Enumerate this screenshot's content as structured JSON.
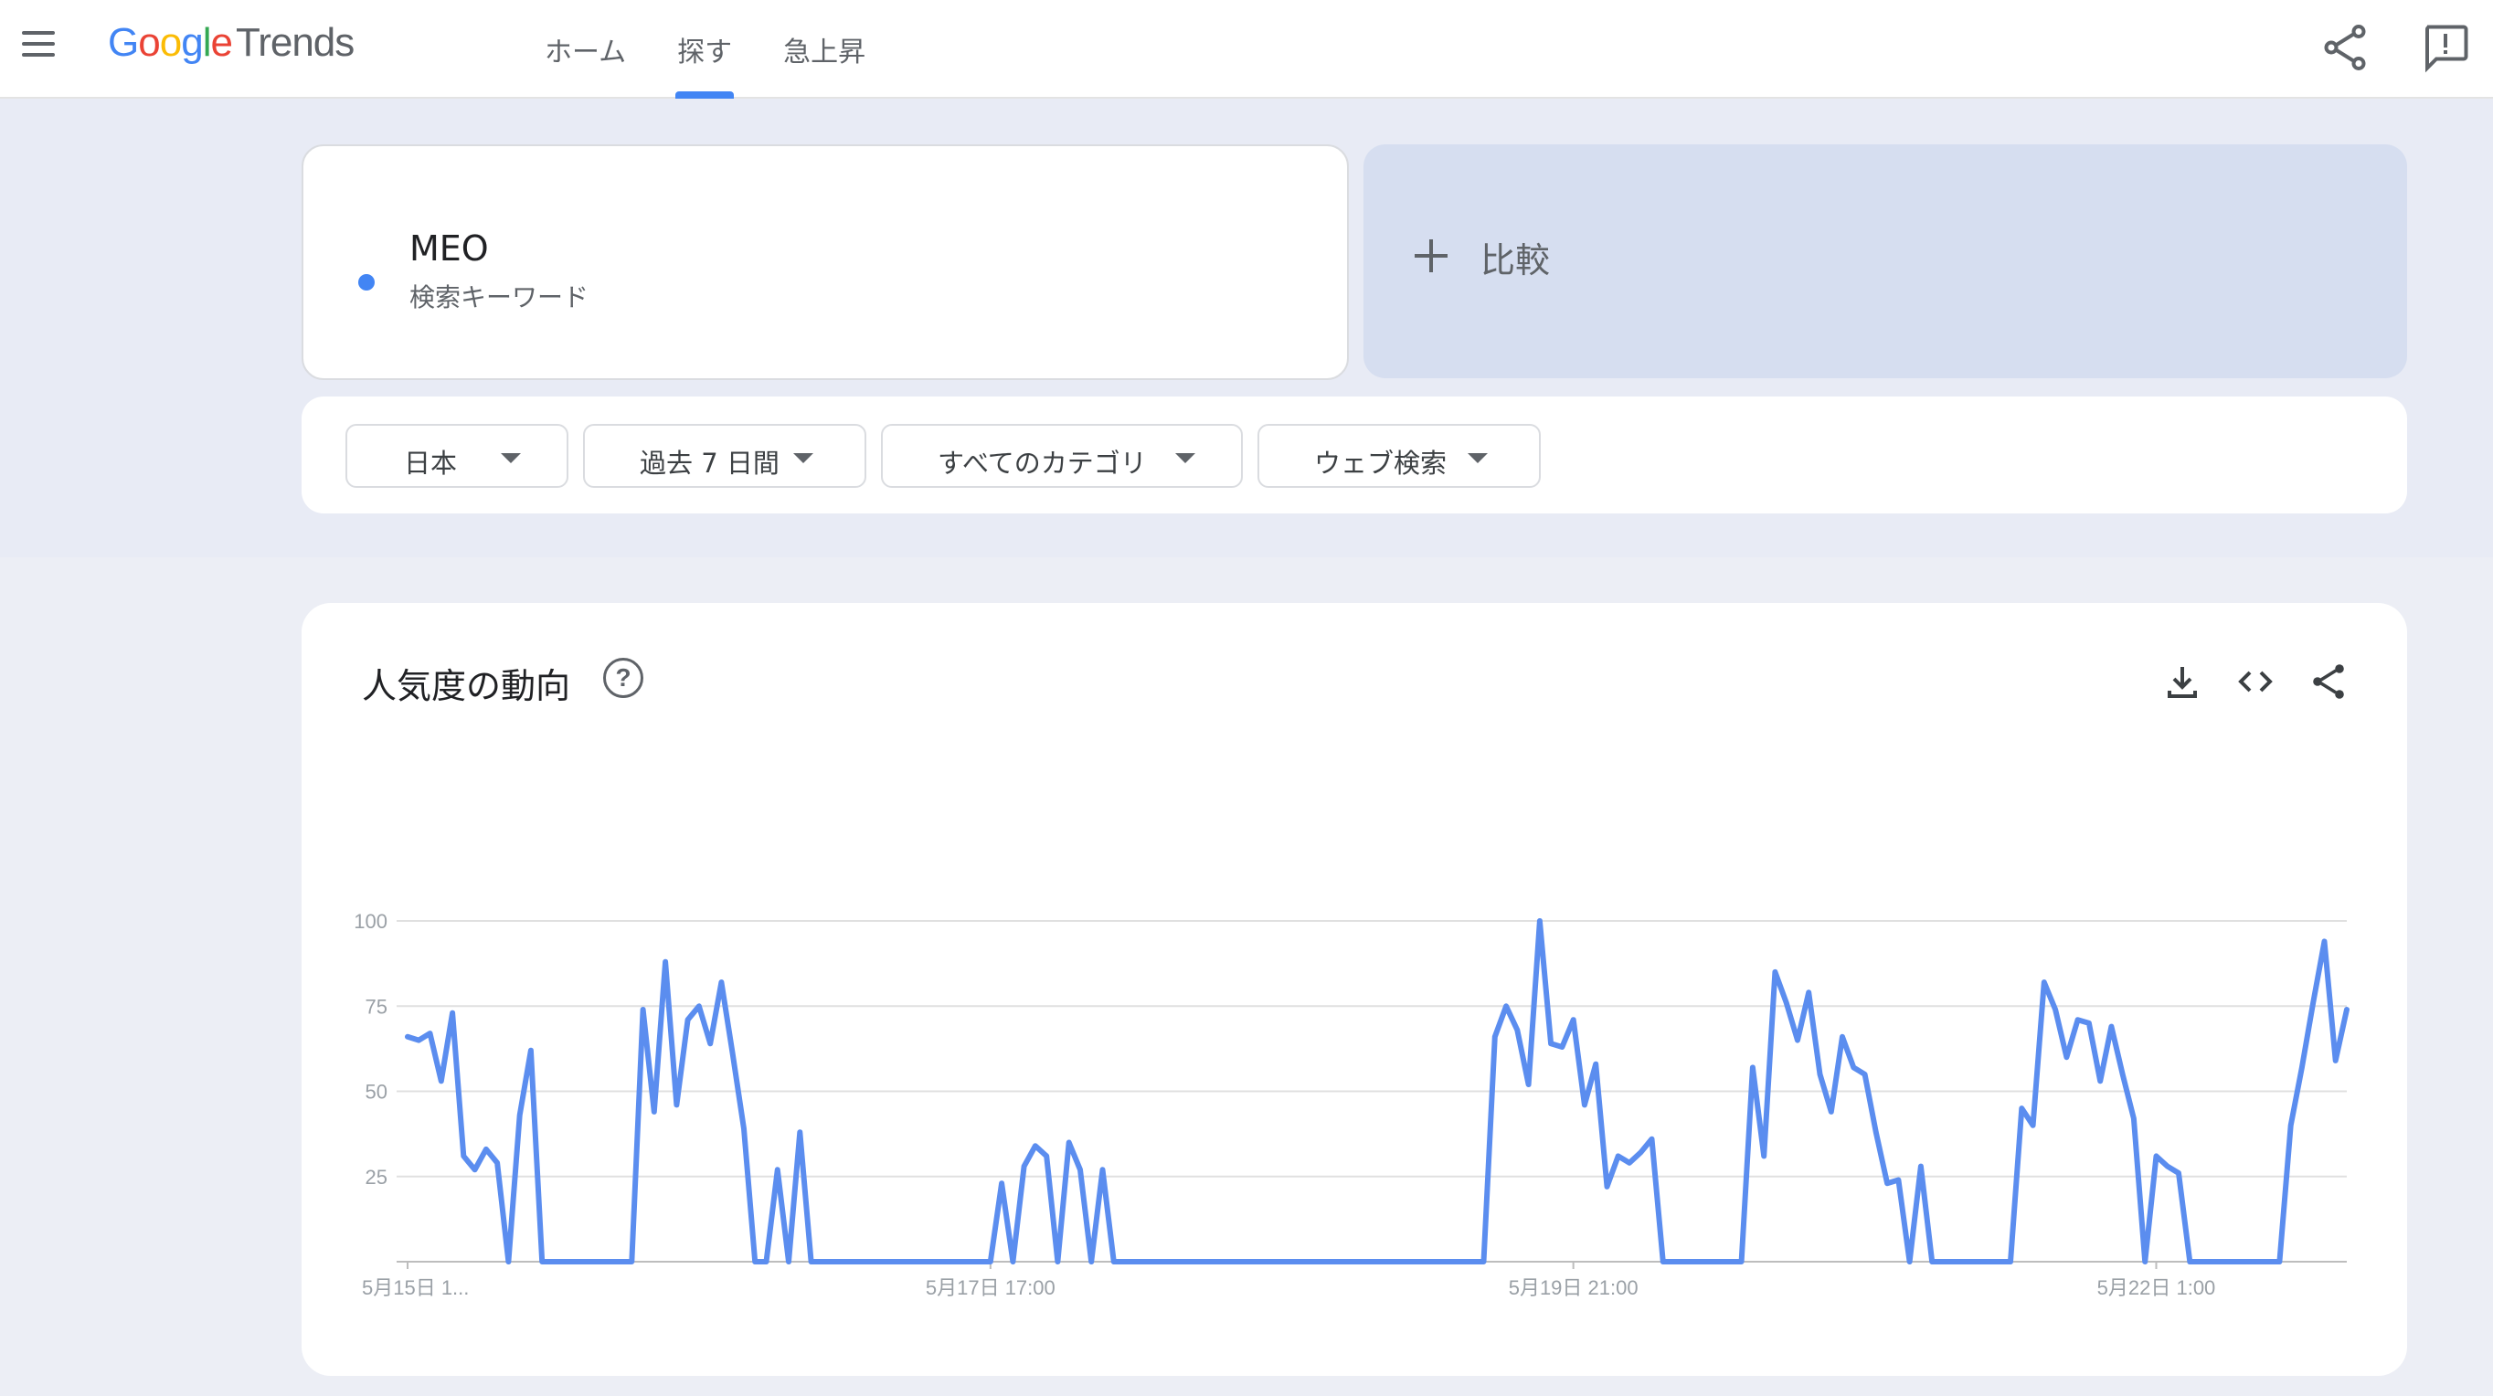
{
  "header": {
    "logo": {
      "google": "Google",
      "trends": "Trends"
    },
    "nav_tabs": [
      {
        "label": "ホーム",
        "active": false
      },
      {
        "label": "探す",
        "active": true
      },
      {
        "label": "急上昇",
        "active": false
      }
    ],
    "icons": [
      "menu-icon",
      "share-icon",
      "feedback-icon"
    ]
  },
  "search": {
    "term": "MEO",
    "term_type": "検索キーワード",
    "term_color": "#4285f4",
    "compare_label": "比較"
  },
  "filters": [
    {
      "label": "日本"
    },
    {
      "label": "過去 7 日間"
    },
    {
      "label": "すべてのカテゴリ"
    },
    {
      "label": "ウェブ検索"
    }
  ],
  "chart_card": {
    "title": "人気度の動向",
    "help_symbol": "?",
    "icons": [
      "download-icon",
      "embed-code-icon",
      "share-icon"
    ]
  },
  "chart_data": {
    "type": "line",
    "title": "人気度の動向",
    "xlabel": "",
    "ylabel": "",
    "ylim": [
      0,
      100
    ],
    "y_ticks": [
      "100",
      "75",
      "50",
      "25"
    ],
    "x_tick_labels": [
      "5月15日 1...",
      "5月17日 17:00",
      "5月19日 21:00",
      "5月22日 1:00"
    ],
    "x_tick_index": [
      0,
      52,
      104,
      156
    ],
    "grid": true,
    "line_color": "#5b8def",
    "series": [
      {
        "values": [
          66,
          65,
          67,
          53,
          73,
          31,
          27,
          33,
          29,
          0,
          43,
          62,
          0,
          0,
          0,
          0,
          0,
          0,
          0,
          0,
          0,
          74,
          44,
          88,
          46,
          71,
          75,
          64,
          82,
          61,
          39,
          0,
          0,
          27,
          0,
          38,
          0,
          0,
          0,
          0,
          0,
          0,
          0,
          0,
          0,
          0,
          0,
          0,
          0,
          0,
          0,
          0,
          0,
          23,
          0,
          28,
          34,
          31,
          0,
          35,
          27,
          0,
          27,
          0,
          0,
          0,
          0,
          0,
          0,
          0,
          0,
          0,
          0,
          0,
          0,
          0,
          0,
          0,
          0,
          0,
          0,
          0,
          0,
          0,
          0,
          0,
          0,
          0,
          0,
          0,
          0,
          0,
          0,
          0,
          0,
          0,
          0,
          66,
          75,
          68,
          52,
          100,
          64,
          63,
          71,
          46,
          58,
          22,
          31,
          29,
          32,
          36,
          0,
          0,
          0,
          0,
          0,
          0,
          0,
          0,
          57,
          31,
          85,
          76,
          65,
          79,
          55,
          44,
          66,
          57,
          55,
          38,
          23,
          24,
          0,
          28,
          0,
          0,
          0,
          0,
          0,
          0,
          0,
          0,
          45,
          40,
          82,
          74,
          60,
          71,
          70,
          53,
          69,
          55,
          42,
          0,
          31,
          28,
          26,
          0,
          0,
          0,
          0,
          0,
          0,
          0,
          0,
          0,
          40,
          57,
          76,
          94,
          59,
          74
        ]
      }
    ]
  }
}
